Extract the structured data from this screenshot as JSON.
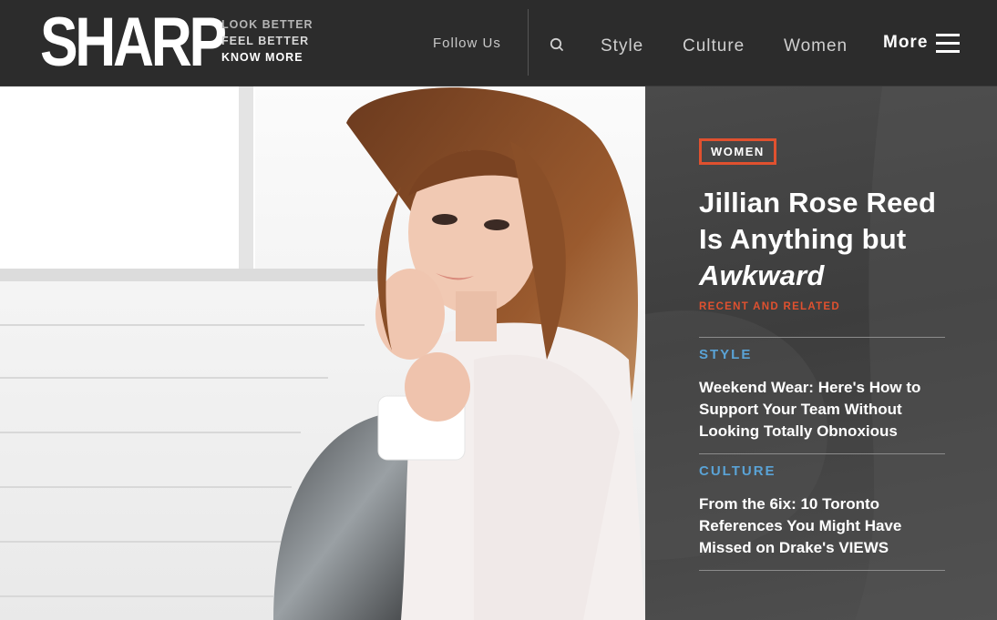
{
  "header": {
    "logo": "SHARP",
    "tagline": [
      "LOOK BETTER",
      "FEEL BETTER",
      "KNOW MORE"
    ],
    "follow_us": "Follow Us",
    "nav": [
      "Style",
      "Culture",
      "Women"
    ],
    "more_label": "More"
  },
  "hero": {
    "category": "WOMEN",
    "headline_line1": "Jillian Rose Reed",
    "headline_line2": "Is Anything but",
    "headline_line3": "Awkward"
  },
  "related": {
    "label": "RECENT AND RELATED",
    "items": [
      {
        "category": "STYLE",
        "title": "Weekend Wear: Here's How to Support Your Team Without Looking Totally Obnoxious"
      },
      {
        "category": "CULTURE",
        "title": "From the 6ix: 10 Toronto References You Might Have Missed on Drake's VIEWS"
      }
    ]
  },
  "colors": {
    "header_bg": "#2c2c2c",
    "accent_orange": "#e0512f",
    "accent_blue": "#5aa3d6"
  }
}
